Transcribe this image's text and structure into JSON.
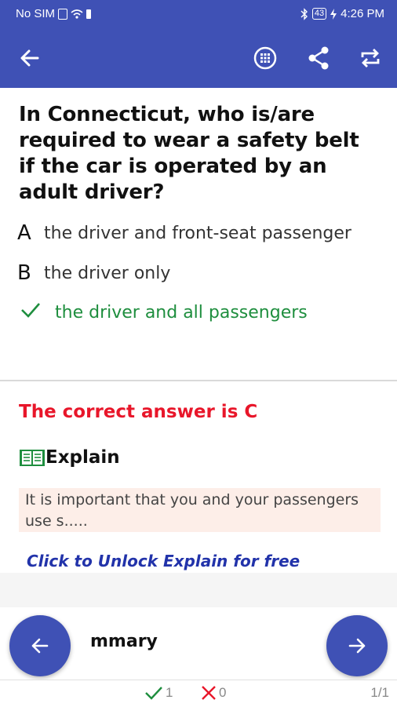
{
  "status_bar": {
    "carrier": "No SIM",
    "battery_level": "43",
    "time": "4:26 PM"
  },
  "app_bar": {
    "back_icon": "arrow-left-icon",
    "actions": [
      "grid-icon",
      "share-icon",
      "repeat-icon"
    ]
  },
  "question": {
    "text": "In Connecticut, who is/are required to wear a safety belt if the car is operated by an adult driver?"
  },
  "options": [
    {
      "letter": "A",
      "text": "the driver and front-seat passenger",
      "state": "normal"
    },
    {
      "letter": "B",
      "text": "the driver only",
      "state": "normal"
    },
    {
      "letter": "",
      "text": "the driver and all passengers",
      "state": "correct",
      "icon": "check-icon"
    }
  ],
  "answer": {
    "correct_text": "The correct answer is C"
  },
  "explain": {
    "title": "Explain",
    "icon": "book-icon",
    "text": "It is important that you and your passengers use s.....",
    "unlock_label": "Click to Unlock Explain for free"
  },
  "summary": {
    "title": "mmary"
  },
  "bottom_bar": {
    "correct_count": "1",
    "wrong_count": "0",
    "page": "1/1"
  },
  "colors": {
    "primary": "#3f51b5",
    "correct": "#1e8e3e",
    "wrong": "#e8162a",
    "explain_bg": "#fdeee8",
    "unlock": "#2233aa"
  }
}
